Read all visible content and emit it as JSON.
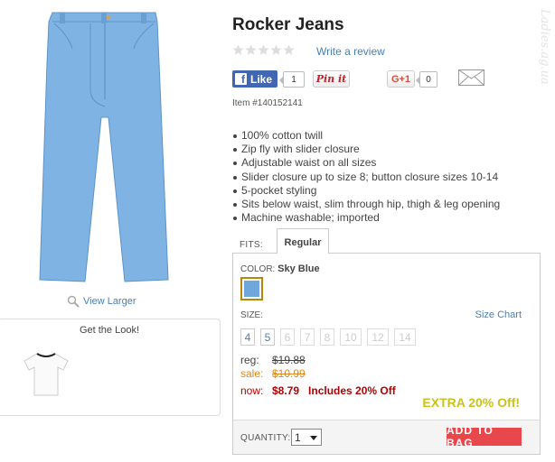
{
  "product": {
    "title": "Rocker Jeans",
    "write_review": "Write a review",
    "rating": 0,
    "rating_max": 5,
    "item_number": "Item #140152141",
    "features": [
      "100% cotton twill",
      "Zip fly with slider closure",
      "Adjustable waist on all sizes",
      "Slider closure up to size 8; button closure sizes 10-14",
      "5-pocket styling",
      "Sits below waist, slim through hip, thigh & leg opening",
      "Machine washable; imported"
    ],
    "view_larger": "View Larger",
    "get_the_look": "Get the Look!",
    "image_color": "#7fb3e3"
  },
  "social": {
    "like_label": "Like",
    "like_count": "1",
    "pinit_label": "Pin it",
    "gplus_label": "G+1",
    "gplus_count": "0"
  },
  "options": {
    "fits_label": "FITS:",
    "fit_tab": "Regular",
    "color_label": "COLOR:",
    "color_value": "Sky Blue",
    "swatch_color": "#6fa7db",
    "size_label": "SIZE:",
    "size_chart": "Size Chart",
    "sizes": [
      {
        "label": "4",
        "available": true
      },
      {
        "label": "5",
        "available": true
      },
      {
        "label": "6",
        "available": false
      },
      {
        "label": "7",
        "available": false
      },
      {
        "label": "8",
        "available": false
      },
      {
        "label": "10",
        "available": false
      },
      {
        "label": "12",
        "available": false
      },
      {
        "label": "14",
        "available": false
      }
    ]
  },
  "pricing": {
    "reg_label": "reg:",
    "reg_value": "$19.88",
    "sale_label": "sale:",
    "sale_value": "$10.99",
    "now_label": "now:",
    "now_value": "$8.79",
    "includes": "Includes 20% Off",
    "extra": "EXTRA 20% Off!"
  },
  "cart": {
    "quantity_label": "QUANTITY:",
    "quantity_value": "1",
    "add_to_bag": "ADD TO BAG"
  },
  "watermark": "Ladies.ag.ua"
}
